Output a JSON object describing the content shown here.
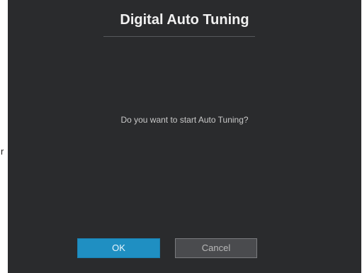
{
  "page": {
    "left_fragment_text": "r"
  },
  "dialog": {
    "title": "Digital Auto Tuning",
    "message": "Do you want to start Auto Tuning?",
    "buttons": {
      "ok_label": "OK",
      "cancel_label": "Cancel"
    },
    "colors": {
      "dialog_background": "#2a2b2d",
      "title_text": "#f1f1f1",
      "message_text": "#c9c9c9",
      "ok_background": "#1f8fc2",
      "cancel_background": "#4a4b4e"
    }
  }
}
